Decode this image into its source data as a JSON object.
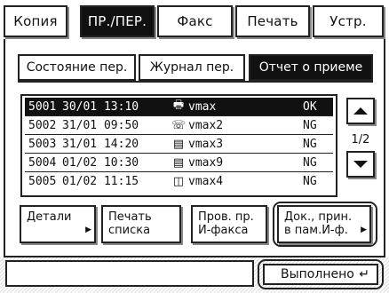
{
  "mode_tabs": [
    {
      "label": "Копия",
      "active": false
    },
    {
      "label": "ПР./ПЕР.",
      "active": true
    },
    {
      "label": "Факс",
      "active": false
    },
    {
      "label": "Печать",
      "active": false
    },
    {
      "label": "Устр.",
      "active": false
    }
  ],
  "sub_tabs": [
    {
      "label": "Состояние пер.",
      "active": false
    },
    {
      "label": "Журнал пер.",
      "active": false
    },
    {
      "label": "Отчет о приеме",
      "active": true
    }
  ],
  "jobs": [
    {
      "id": "5001",
      "datetime": "30/01 13:10",
      "icon": "printer-icon",
      "name": "vmax",
      "status": "OK",
      "selected": true
    },
    {
      "id": "5002",
      "datetime": "31/01 09:50",
      "icon": "internet-fax-icon",
      "name": "vmax2",
      "status": "NG",
      "selected": false
    },
    {
      "id": "5003",
      "datetime": "31/01 14:20",
      "icon": "memory-box-icon",
      "name": "vmax3",
      "status": "NG",
      "selected": false
    },
    {
      "id": "5004",
      "datetime": "01/02 10:30",
      "icon": "memory-box-icon",
      "name": "vmax9",
      "status": "NG",
      "selected": false
    },
    {
      "id": "5005",
      "datetime": "01/02 11:15",
      "icon": "inbox-icon",
      "name": "vmax4",
      "status": "NG",
      "selected": false
    }
  ],
  "pagination": {
    "indicator": "1/2"
  },
  "actions": {
    "details_label": "Детали",
    "print_list_line1": "Печать",
    "print_list_line2": "списка",
    "check_ifax_line1": "Пров. пр.",
    "check_ifax_line2": "И-факса",
    "docs_memory_line1": "Док., прин.",
    "docs_memory_line2": "в пам.И-ф."
  },
  "footer": {
    "done_label": "Выполнено"
  }
}
